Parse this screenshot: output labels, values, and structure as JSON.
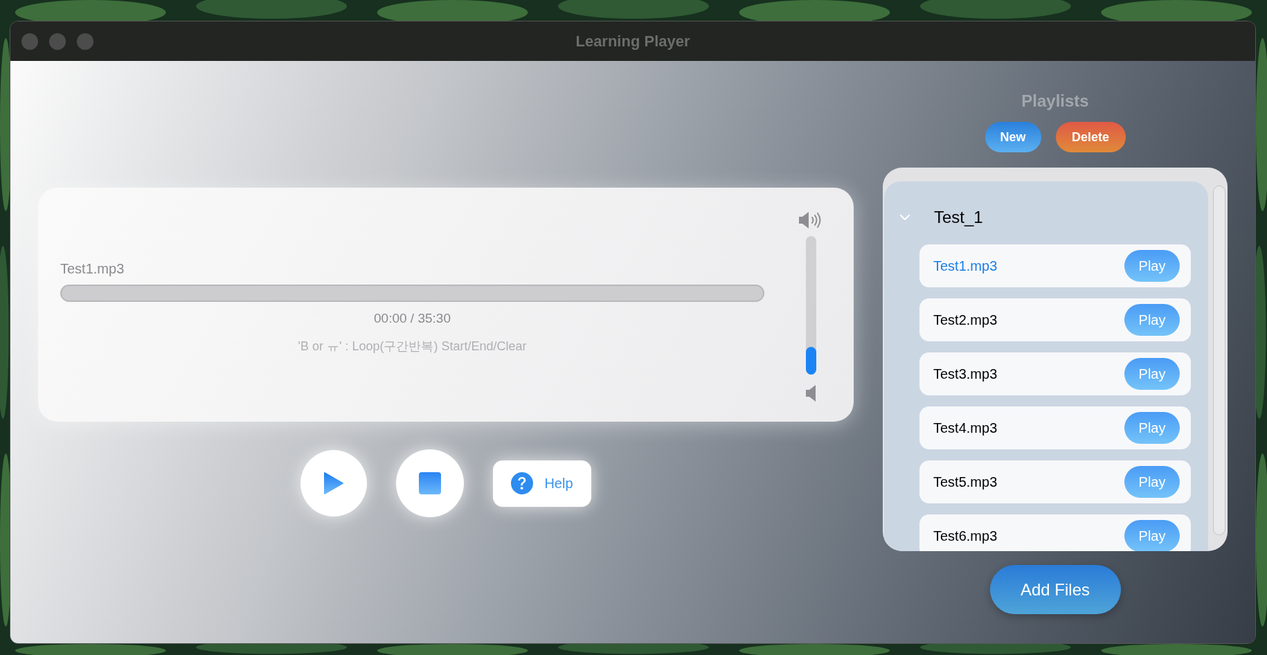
{
  "window": {
    "title": "Learning Player"
  },
  "player": {
    "file_name": "Test1.mp3",
    "progress": {
      "level": 0
    },
    "time": "00:00 / 35:30",
    "hint": "'B or ㅠ' : Loop(구간반복) Start/End/Clear",
    "volume": {
      "level": 0.2
    }
  },
  "controls": [
    {
      "kind": "play"
    },
    {
      "kind": "stop"
    },
    {
      "kind": "help",
      "label": "Help"
    }
  ],
  "playlists": {
    "title": "Playlists",
    "buttons": [
      {
        "kind": "new",
        "label": "New"
      },
      {
        "kind": "delete",
        "label": "Delete"
      }
    ],
    "groups": [
      {
        "name": "Test_1",
        "expanded": true,
        "tracks": [
          {
            "name": "Test1.mp3",
            "selected": true,
            "button": "Play"
          },
          {
            "name": "Test2.mp3",
            "selected": false,
            "button": "Play"
          },
          {
            "name": "Test3.mp3",
            "selected": false,
            "button": "Play"
          },
          {
            "name": "Test4.mp3",
            "selected": false,
            "button": "Play"
          },
          {
            "name": "Test5.mp3",
            "selected": false,
            "button": "Play"
          },
          {
            "name": "Test6.mp3",
            "selected": false,
            "button": "Play"
          }
        ]
      }
    ],
    "add_button": "Add Files"
  }
}
